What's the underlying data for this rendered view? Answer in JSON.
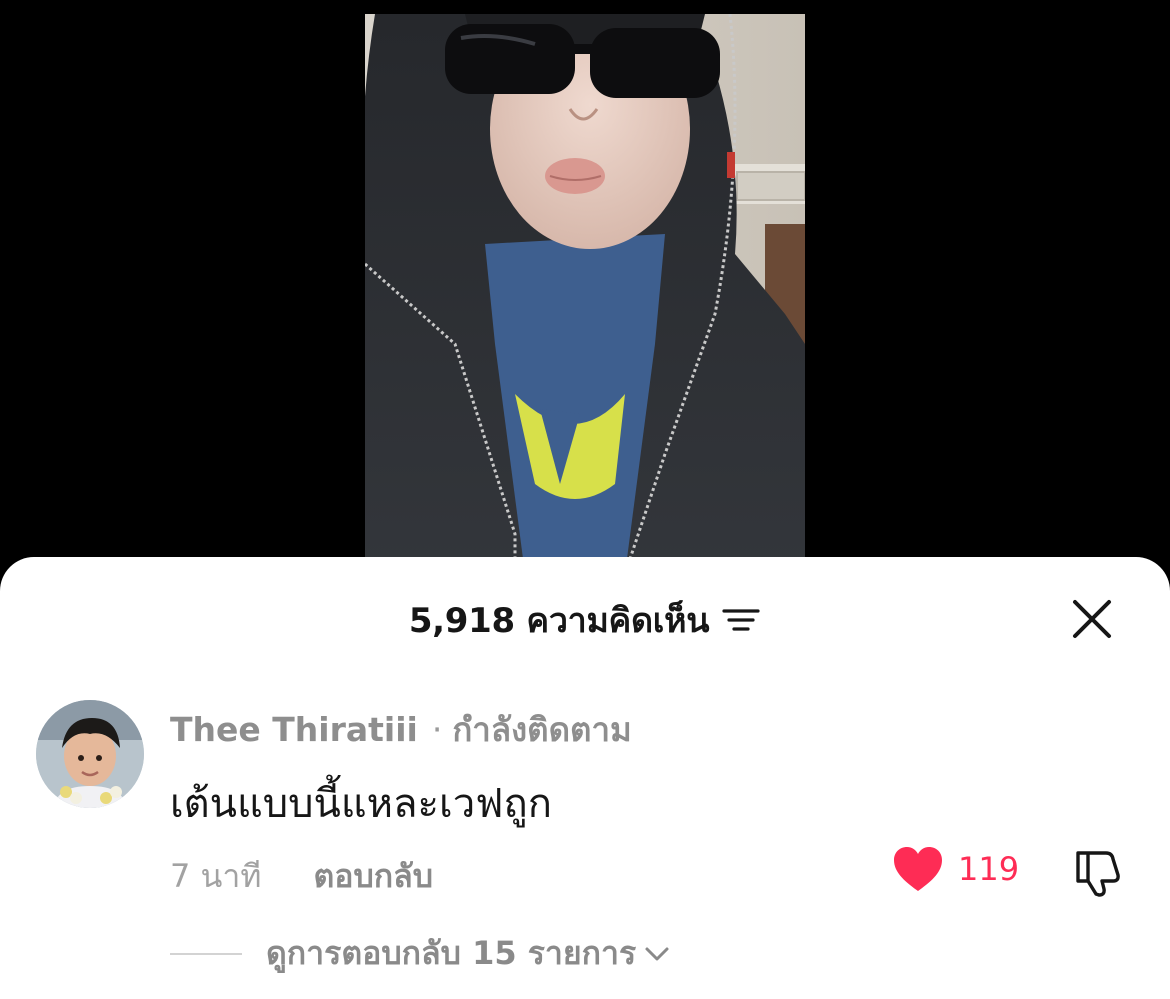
{
  "comments_sheet": {
    "title": "5,918 ความคิดเห็น",
    "sort_icon": "sort-lines-icon",
    "close_icon": "close-icon"
  },
  "comment": {
    "username": "Thee Thiratiii",
    "separator": "·",
    "follow_state": "กำลังติดตาม",
    "text": "เต้นแบบนี้แหละเวฟถูก",
    "time": "7 นาที",
    "reply_label": "ตอบกลับ",
    "likes": "119",
    "like_icon": "heart-icon",
    "dislike_icon": "thumbs-down-icon",
    "view_replies_label": "ดูการตอบกลับ 15 รายการ",
    "view_replies_icon": "chevron-down-icon"
  },
  "colors": {
    "accent": "#fe2c55",
    "background": "#000000",
    "sheet": "#ffffff",
    "muted_text": "#8a8a8a"
  }
}
